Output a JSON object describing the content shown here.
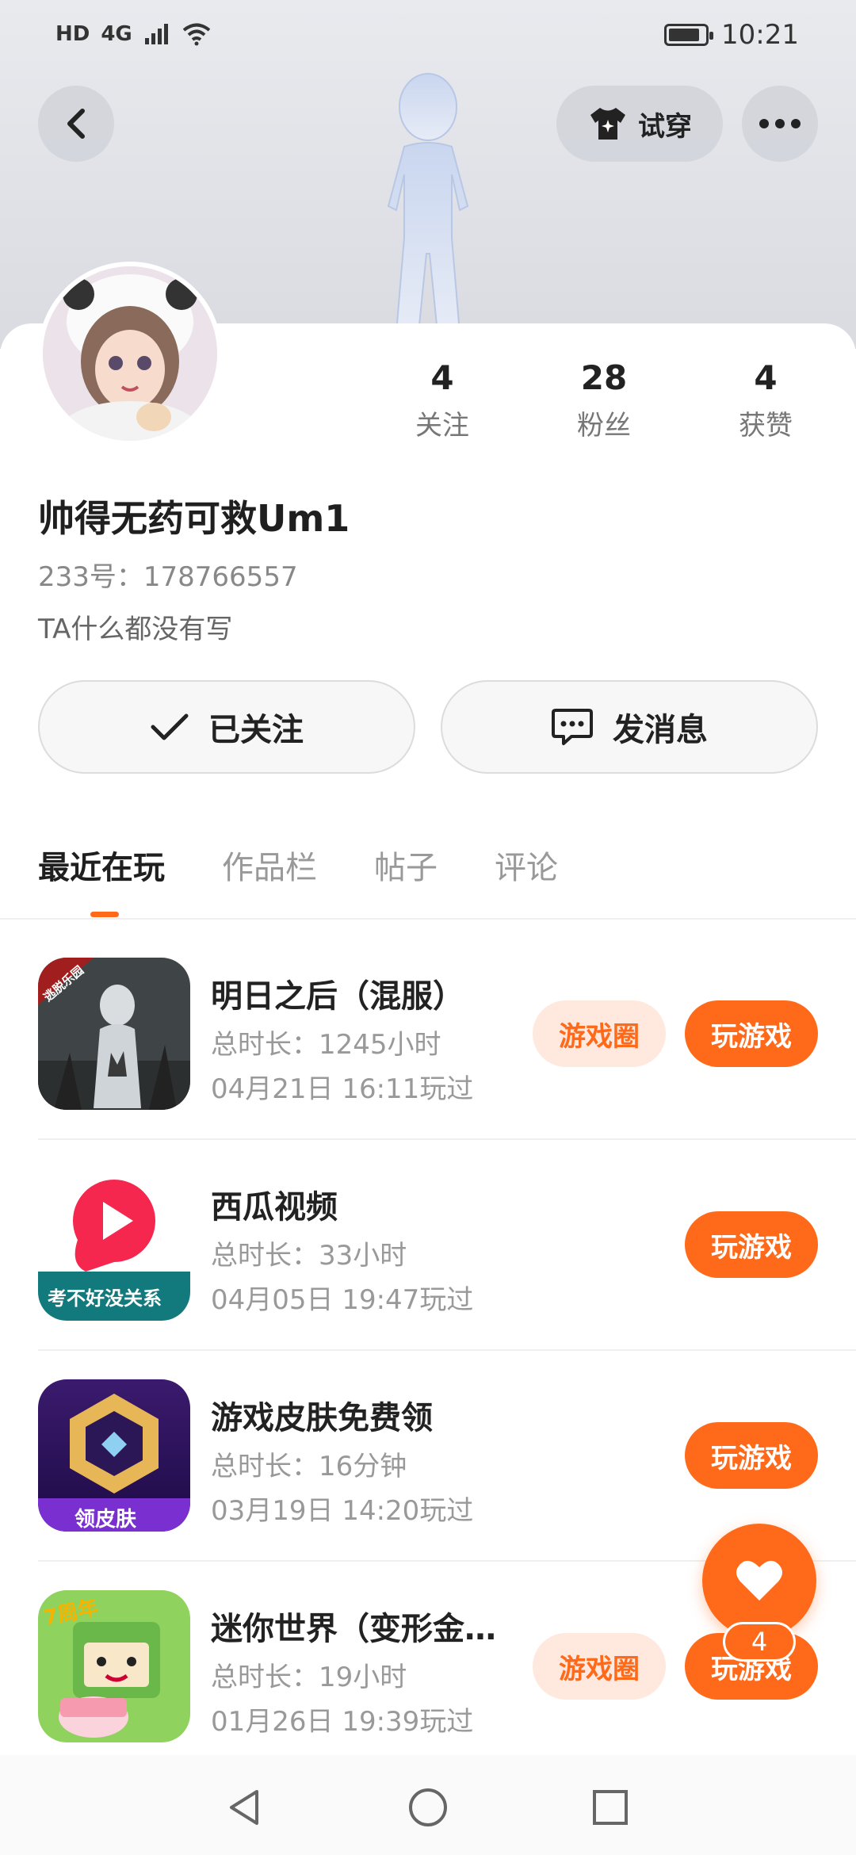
{
  "status_bar": {
    "left": [
      "HD",
      "4G"
    ],
    "time": "10:21"
  },
  "header": {
    "try_on_label": "试穿"
  },
  "profile": {
    "name": "帅得无药可救Um1",
    "uid": "233号：178766557",
    "bio": "TA什么都没有写",
    "stats": [
      {
        "value": "4",
        "label": "关注"
      },
      {
        "value": "28",
        "label": "粉丝"
      },
      {
        "value": "4",
        "label": "获赞"
      }
    ]
  },
  "actions": {
    "followed": "已关注",
    "message": "发消息"
  },
  "tabs": [
    "最近在玩",
    "作品栏",
    "帖子",
    "评论"
  ],
  "games": [
    {
      "title": "明日之后（混服）",
      "duration": "总时长：1245小时",
      "last_played": "04月21日 16:11玩过",
      "badge": "逃脱乐园",
      "has_circle": true,
      "circle_label": "游戏圈",
      "play_label": "玩游戏"
    },
    {
      "title": "西瓜视频",
      "duration": "总时长：33小时",
      "last_played": "04月05日 19:47玩过",
      "badge": "考不好没关系",
      "has_circle": false,
      "play_label": "玩游戏"
    },
    {
      "title": "游戏皮肤免费领",
      "duration": "总时长：16分钟",
      "last_played": "03月19日 14:20玩过",
      "badge": "领皮肤",
      "has_circle": false,
      "play_label": "玩游戏"
    },
    {
      "title": "迷你世界（变形金…",
      "duration": "总时长：19小时",
      "last_played": "01月26日 19:39玩过",
      "badge": "7周年",
      "has_circle": true,
      "circle_label": "游戏圈",
      "play_label": "玩游戏"
    }
  ],
  "fab": {
    "count": "4"
  },
  "colors": {
    "accent": "#ff6a1a",
    "accent_light": "#ffe9de"
  }
}
